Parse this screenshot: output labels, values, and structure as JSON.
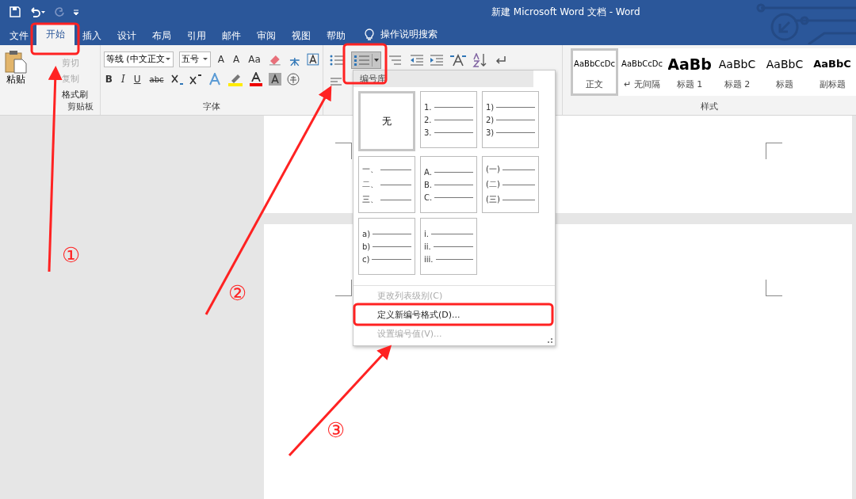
{
  "window": {
    "title": "新建 Microsoft Word 文档  -  Word"
  },
  "tabs": [
    {
      "label": "文件",
      "selected": false
    },
    {
      "label": "开始",
      "selected": true
    },
    {
      "label": "插入",
      "selected": false
    },
    {
      "label": "设计",
      "selected": false
    },
    {
      "label": "布局",
      "selected": false
    },
    {
      "label": "引用",
      "selected": false
    },
    {
      "label": "邮件",
      "selected": false
    },
    {
      "label": "审阅",
      "selected": false
    },
    {
      "label": "视图",
      "selected": false
    },
    {
      "label": "帮助",
      "selected": false
    }
  ],
  "tell_me": "操作说明搜索",
  "clipboard": {
    "paste": "粘贴",
    "items": [
      {
        "label": "剪切",
        "disabled": true
      },
      {
        "label": "复制",
        "disabled": true
      },
      {
        "label": "格式刷",
        "disabled": false
      }
    ],
    "group": "剪贴板"
  },
  "font": {
    "name": "等线 (中文正文",
    "size": "五号",
    "tools": [
      "A",
      "A",
      "Aa"
    ],
    "buttons": [
      "B",
      "I",
      "U",
      "abc"
    ],
    "group": "字体"
  },
  "styles": {
    "items": [
      {
        "sample": "AaBbCcDc",
        "label": "正文",
        "kind": "small",
        "selected": true
      },
      {
        "sample": "AaBbCcDc",
        "label": "↵ 无间隔",
        "kind": "small",
        "selected": false
      },
      {
        "sample": "AaBb",
        "label": "标题 1",
        "kind": "huge",
        "selected": false
      },
      {
        "sample": "AaBbC",
        "label": "标题 2",
        "kind": "large",
        "selected": false
      },
      {
        "sample": "AaBbC",
        "label": "标题",
        "kind": "large",
        "selected": false
      },
      {
        "sample": "AaBbC",
        "label": "副标题",
        "kind": "bold",
        "selected": false
      }
    ],
    "group": "样式"
  },
  "numbering_menu": {
    "title": "编号库",
    "formats": [
      {
        "kind": "none",
        "label": "无",
        "selected": true
      },
      {
        "kind": "list",
        "markers": [
          "1.",
          "2.",
          "3."
        ],
        "selected": false
      },
      {
        "kind": "list",
        "markers": [
          "1)",
          "2)",
          "3)"
        ],
        "selected": false
      },
      {
        "kind": "list",
        "markers": [
          "一、",
          "二、",
          "三、"
        ],
        "selected": false
      },
      {
        "kind": "list",
        "markers": [
          "A.",
          "B.",
          "C."
        ],
        "selected": false
      },
      {
        "kind": "list",
        "markers": [
          "(一)",
          "(二)",
          "(三)"
        ],
        "selected": false
      },
      {
        "kind": "list",
        "markers": [
          "a)",
          "b)",
          "c)"
        ],
        "selected": false
      },
      {
        "kind": "list",
        "markers": [
          "i.",
          "ii.",
          "iii."
        ],
        "selected": false
      }
    ],
    "commands": [
      {
        "label": "更改列表级别(C)",
        "disabled": true
      },
      {
        "label": "定义新编号格式(D)...",
        "disabled": false
      },
      {
        "label": "设置编号值(V)...",
        "disabled": true
      }
    ]
  },
  "annotations": [
    "①",
    "②",
    "③"
  ]
}
